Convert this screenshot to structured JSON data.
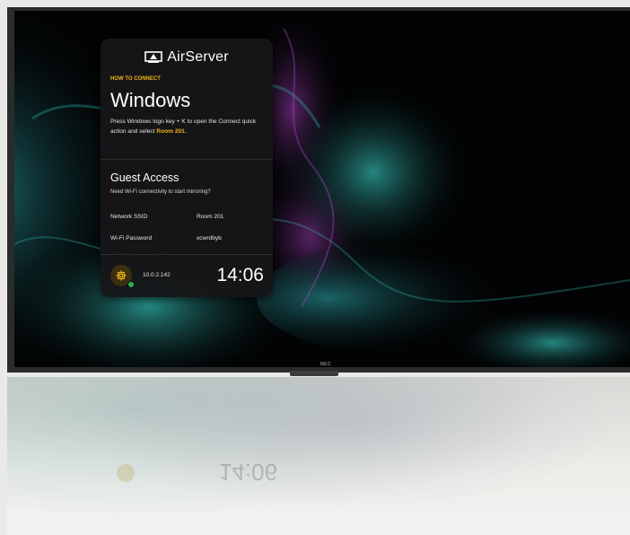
{
  "device": {
    "brand_label": "NEC"
  },
  "card": {
    "brand_name": "AirServer",
    "section_label": "HOW TO CONNECT",
    "os_title": "Windows",
    "instructions_prefix": "Press Windows logo key + K to open the Connect quick action and select ",
    "instructions_highlight": "Room 201",
    "instructions_suffix": ".",
    "guest": {
      "title": "Guest Access",
      "subtitle": "Need Wi-Fi connectivity to start mirroring?",
      "rows": [
        {
          "label": "Network SSID",
          "value": "Room 201"
        },
        {
          "label": "Wi-Fi Password",
          "value": "xcwrdbyb"
        }
      ]
    },
    "footer": {
      "ip_address": "10.0.2.142",
      "time": "14:06",
      "status": "connected"
    }
  },
  "reflection": {
    "time": "14:06"
  },
  "colors": {
    "accent": "#f2b21b",
    "status_green": "#22b24c",
    "card_bg": "#161618"
  },
  "icons": {
    "brand": "airplay-icon",
    "settings": "gear-icon"
  }
}
